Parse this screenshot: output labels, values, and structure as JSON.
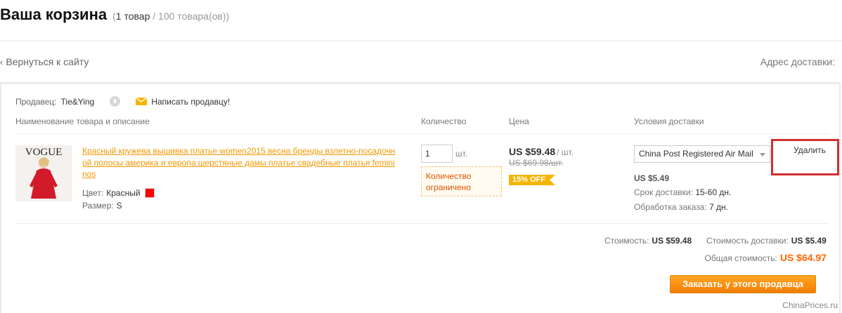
{
  "header": {
    "title": "Ваша корзина",
    "count_open": "(",
    "count_current": "1 товар",
    "count_rest": " / 100 товара(ов))"
  },
  "nav": {
    "back_label": "Вернуться к сайту",
    "address_label": "Адрес доставки:"
  },
  "seller": {
    "label": "Продавец:",
    "name": "Tie&Ying",
    "message_label": "Написать продавцу!"
  },
  "columns": {
    "product": "Наименование товара и описание",
    "quantity": "Количество",
    "price": "Цена",
    "shipping": "Условия доставки"
  },
  "item": {
    "thumb_text": "VOGUE",
    "title": "Красный кружева вышивка платье women2015 весна бренды взлетно-посадочной полосы америка и европа шерстяные дамы платье свадебные платья femininos",
    "color_label": "Цвет:",
    "color_value": "Красный",
    "color_hex": "#ff0000",
    "size_label": "Размер:",
    "size_value": "S",
    "quantity": "1",
    "quantity_unit": "шт.",
    "quantity_limited": "Количество ограничено",
    "price": "US $59.48",
    "price_unit": "/ шт.",
    "old_price": "US $69.98/шт.",
    "discount": "15% OFF",
    "shipping_method": "China Post Registered Air Mail",
    "shipping_cost": "US $5.49",
    "delivery_label": "Срок доставки:",
    "delivery_value": "15-60 дн.",
    "processing_label": "Обработка заказа:",
    "processing_value": "7 дн.",
    "delete_label": "Удалить"
  },
  "summary": {
    "cost_label": "Стоимость:",
    "cost_value": "US $59.48",
    "shipping_label": "Стоимость доставки:",
    "shipping_value": "US $5.49",
    "total_label": "Общая стоимость:",
    "total_value": "US $64.97",
    "order_button": "Заказать у этого продавца"
  },
  "watermark": "ChinaPrices.ru",
  "colors": {
    "accent_orange": "#f39800",
    "total_orange": "#ff6600",
    "highlight_red": "#d32f2f"
  }
}
